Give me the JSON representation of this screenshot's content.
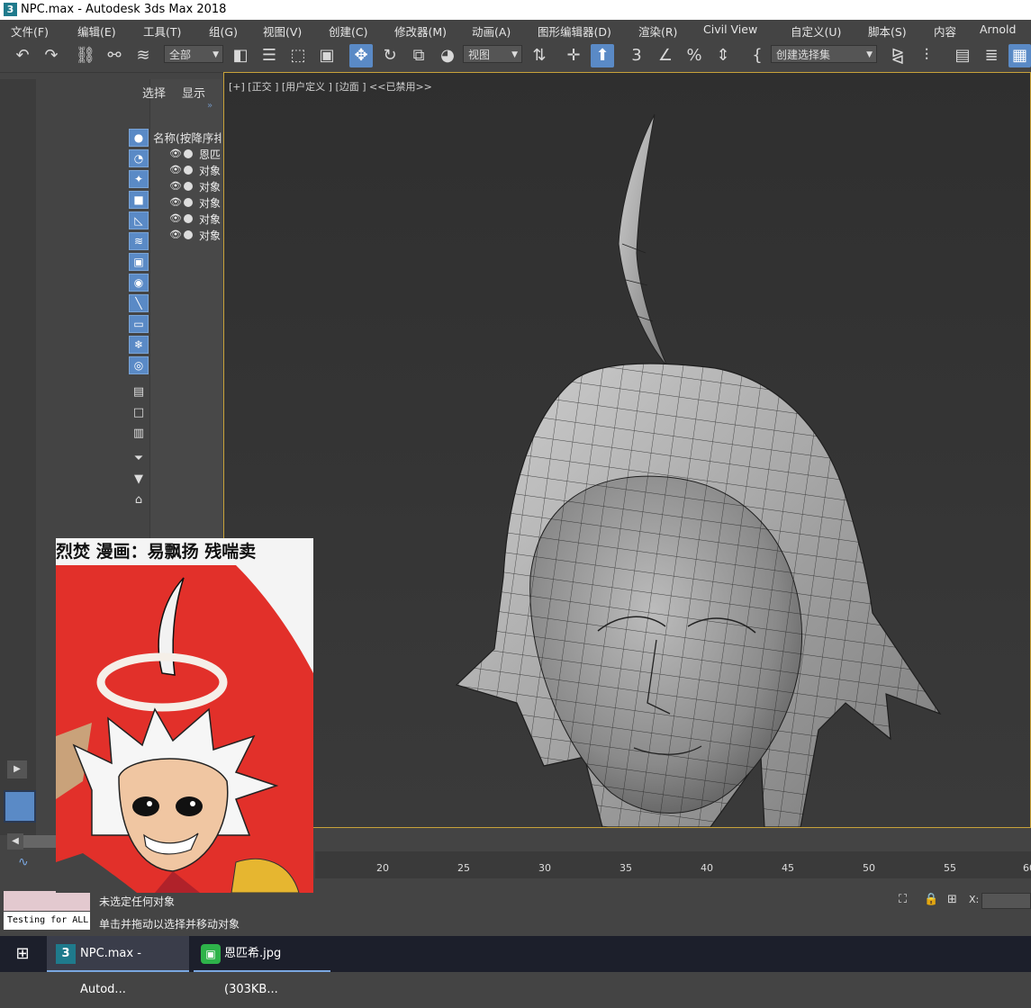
{
  "window": {
    "title": "NPC.max - Autodesk 3ds Max 2018",
    "app_icon": "3"
  },
  "menu": [
    "文件(F)",
    "编辑(E)",
    "工具(T)",
    "组(G)",
    "视图(V)",
    "创建(C)",
    "修改器(M)",
    "动画(A)",
    "图形编辑器(D)",
    "渲染(R)",
    "Civil View",
    "自定义(U)",
    "脚本(S)",
    "内容",
    "Arnold"
  ],
  "toolbar": {
    "selection_filter": "全部",
    "ref_coord": "视图",
    "named_selection": "创建选择集",
    "icons": [
      "undo-icon",
      "redo-icon",
      "link-icon",
      "unlink-icon",
      "bind-space-warp-icon",
      "select-object-icon",
      "select-by-name-icon",
      "rect-region-icon",
      "window-crossing-icon",
      "select-move-icon",
      "select-rotate-icon",
      "select-scale-icon",
      "place-icon",
      "pivot-icon",
      "keyboard-shortcut-icon",
      "snap-3d-icon",
      "angle-snap-icon",
      "percent-snap-icon",
      "spinner-snap-icon",
      "edit-named-sets-icon",
      "mirror-icon",
      "align-icon",
      "toggle-scene-explorer-icon",
      "toggle-layer-explorer-icon",
      "toggle-ribbon-icon"
    ]
  },
  "scene_explorer": {
    "tabs": [
      "选择",
      "显示"
    ],
    "column_header": "名称(按降序排",
    "rows": [
      {
        "name": "恩匹"
      },
      {
        "name": "对象"
      },
      {
        "name": "对象"
      },
      {
        "name": "对象"
      },
      {
        "name": "对象"
      },
      {
        "name": "对象"
      }
    ],
    "filter_icons": [
      "display-geometry-icon",
      "display-shapes-icon",
      "display-lights-icon",
      "display-cameras-icon",
      "display-helpers-icon",
      "display-spacewarps-icon",
      "display-groups-icon",
      "display-xrefs-icon",
      "display-bones-icon",
      "display-containers-icon",
      "display-frozen-icon",
      "display-hidden-icon",
      "display-all-icon",
      "display-none-icon",
      "invert-display-icon",
      "filter-selection-icon",
      "filter-icon",
      "container-icon"
    ]
  },
  "viewport": {
    "label": "[+] [正交 ] [用户定义 ] [边面 ] <<已禁用>>",
    "border_color": "#c8a23a"
  },
  "image_viewer": {
    "caption": "烈焚   漫画：易飘扬   残喘卖"
  },
  "timeline": {
    "ticks": [
      "20",
      "25",
      "30",
      "35",
      "40",
      "45",
      "50",
      "55",
      "60"
    ]
  },
  "status": {
    "line1": "未选定任何对象",
    "line2": "单击并拖动以选择并移动对象",
    "listener": "Testing for ALL",
    "x_label": "X:"
  },
  "taskbar": {
    "items": [
      {
        "label": "NPC.max - Autod...",
        "icon": "3dsmax-icon",
        "active": true
      },
      {
        "label": "恩匹希.jpg (303KB...",
        "icon": "image-viewer-icon",
        "active": false
      }
    ]
  },
  "colors": {
    "accent": "#5a8ac6",
    "viewport_border": "#c8a23a",
    "panel_bg": "#444444"
  }
}
